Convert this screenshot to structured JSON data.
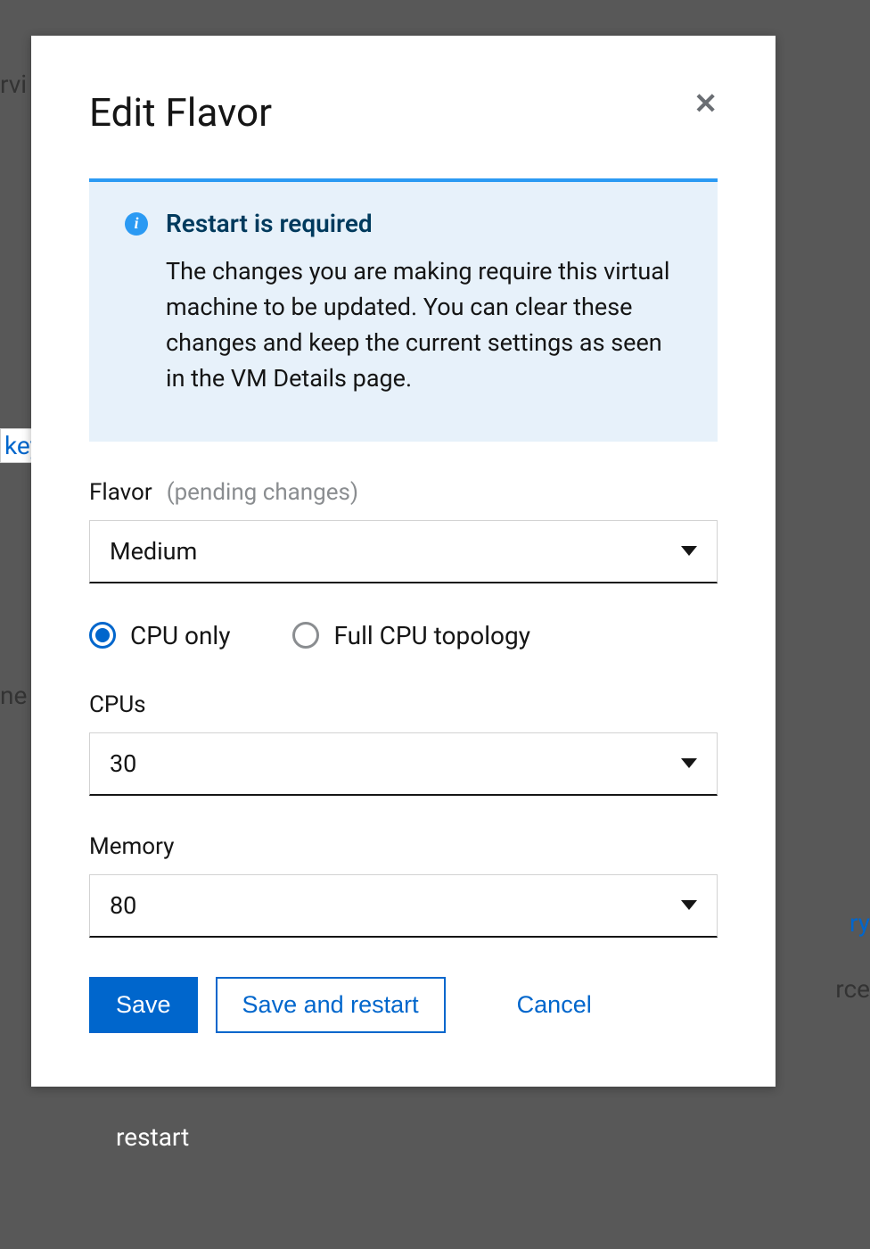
{
  "modal": {
    "title": "Edit Flavor",
    "info": {
      "title": "Restart is required",
      "body": "The changes you are making require this virtual machine to be updated. You can clear these changes and keep the current settings as seen in the VM Details page."
    },
    "flavor": {
      "label": "Flavor",
      "pending": "(pending changes)",
      "value": "Medium"
    },
    "cpu_mode": {
      "options": [
        "CPU only",
        "Full CPU topology"
      ],
      "selected": "CPU only"
    },
    "cpus": {
      "label": "CPUs",
      "value": "30"
    },
    "memory": {
      "label": "Memory",
      "value": "80"
    },
    "buttons": {
      "save": "Save",
      "save_restart": "Save and restart",
      "cancel": "Cancel"
    }
  },
  "background": {
    "frag1": "rvi",
    "frag2": "key",
    "frag3": "ne v",
    "frag4": "ry",
    "frag5": "rce",
    "frag6": "restart"
  }
}
